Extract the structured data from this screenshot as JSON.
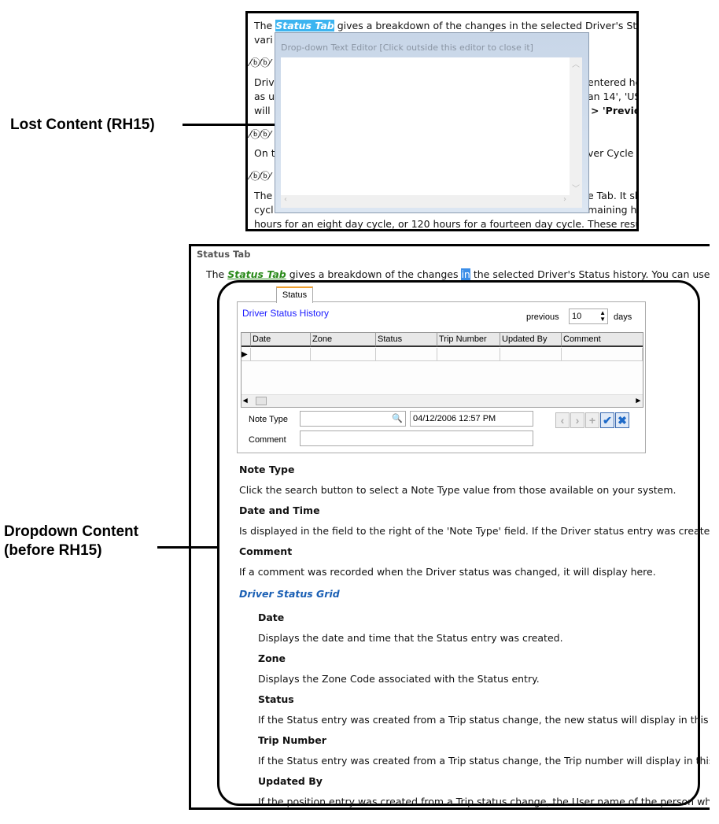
{
  "annotations": {
    "lost": "Lost Content (RH15)",
    "dropdown_1": "Dropdown  Content",
    "dropdown_2": "(before RH15)"
  },
  "top": {
    "lines": [
      "gives a breakdown of the changes in the selected Driver's Status",
      "vari",
      "Driv",
      "entered he",
      "as u",
      "an 14', 'US",
      "will",
      "> 'Previo",
      "On t",
      "ver Cycle T",
      "The",
      "e Tab. It sh",
      "cycl",
      "maining ho",
      "hours for an eight day cycle, or 120 hours for a fourteen day cycle. These results"
    ],
    "the": "The",
    "link": "Status Tab",
    "icons": "⁄ⓑ⁄ⓑ⁄",
    "popup": {
      "title": "Drop-down Text Editor [Click outside this editor to close it]"
    }
  },
  "bottom": {
    "heading": "Status Tab",
    "intro": {
      "pre": "The",
      "link": "Status Tab",
      "mid": "gives a breakdown of the changes",
      "hl": "in",
      "post": "the selected Driver's Status history. You can use this"
    },
    "dialog": {
      "tab": "Status",
      "title": "Driver Status History",
      "previous": "previous",
      "days_value": "10",
      "days": "days",
      "columns": [
        "Date",
        "Zone",
        "Status",
        "Trip Number",
        "Updated By",
        "Comment"
      ],
      "note_type_label": "Note Type",
      "date_value": "04/12/2006 12:57 PM",
      "comment_label": "Comment"
    },
    "sections": [
      {
        "h": "Note Type",
        "t": "Click the search button to select a Note Type value from those available on your system."
      },
      {
        "h": "Date and Time",
        "t": "Is displayed in the field to the right of the 'Note Type' field. If the Driver status entry was created"
      },
      {
        "h": "Comment",
        "t": "If a comment was recorded when the Driver status was changed, it will display here."
      }
    ],
    "grid_heading": "Driver Status Grid",
    "grid_sections": [
      {
        "h": "Date",
        "t": "Displays the date and time that the Status entry was created."
      },
      {
        "h": "Zone",
        "t": "Displays the Zone Code associated with the Status entry."
      },
      {
        "h": "Status",
        "t": "If the Status entry was created from a Trip status change, the new status will display in this fie"
      },
      {
        "h": "Trip Number",
        "t": "If the Status entry was created from a Trip status change, the Trip number will display in this f"
      },
      {
        "h": "Updated By",
        "t": "If the position entry was created from a Trip status change, the User name of the person who"
      }
    ]
  },
  "colors": {
    "highlight": "#3cb4f0",
    "link_green": "#2a8a1a",
    "dialog_blue": "#1a1aff",
    "grid_heading": "#1a5fb4"
  }
}
